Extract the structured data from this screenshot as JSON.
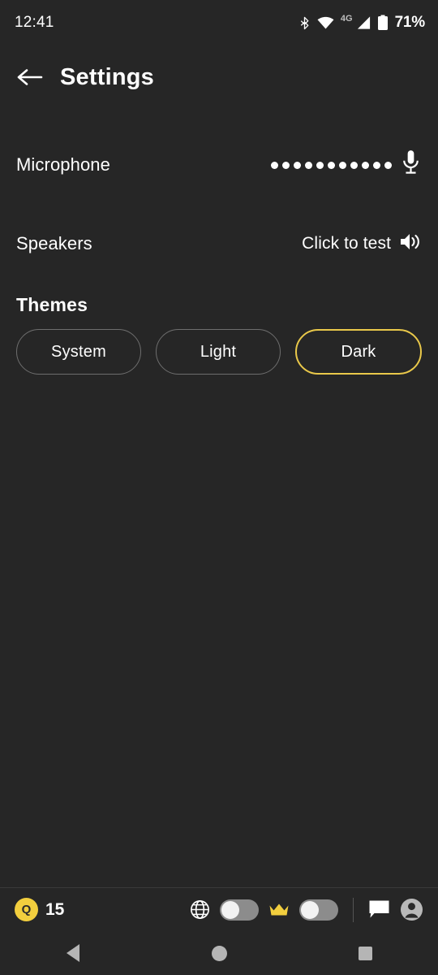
{
  "status_bar": {
    "time": "12:41",
    "network_label": "4G",
    "battery_text": "71%",
    "icons": [
      "bluetooth-icon",
      "wifi-icon",
      "cellular-signal-icon",
      "battery-icon"
    ]
  },
  "header": {
    "back_icon": "back-arrow-icon",
    "title": "Settings"
  },
  "settings": {
    "microphone": {
      "label": "Microphone",
      "meter_dots": 11,
      "icon": "microphone-icon"
    },
    "speakers": {
      "label": "Speakers",
      "action_text": "Click to test",
      "icon": "speaker-icon"
    },
    "themes": {
      "title": "Themes",
      "options": [
        {
          "label": "System",
          "selected": false
        },
        {
          "label": "Light",
          "selected": false
        },
        {
          "label": "Dark",
          "selected": true
        }
      ],
      "selected_color": "#e9c84a"
    }
  },
  "bottom_bar": {
    "coin": {
      "glyph": "Q",
      "count": "15",
      "color": "#f2ce3e"
    },
    "globe_icon": "globe-icon",
    "globe_toggle": {
      "state": "off"
    },
    "crown_icon": "crown-icon",
    "crown_toggle": {
      "state": "off"
    },
    "chat_icon": "chat-bubble-icon",
    "avatar_icon": "user-avatar-icon"
  },
  "nav_bar": {
    "back": "nav-back-icon",
    "home": "nav-home-icon",
    "recents": "nav-recents-icon"
  }
}
